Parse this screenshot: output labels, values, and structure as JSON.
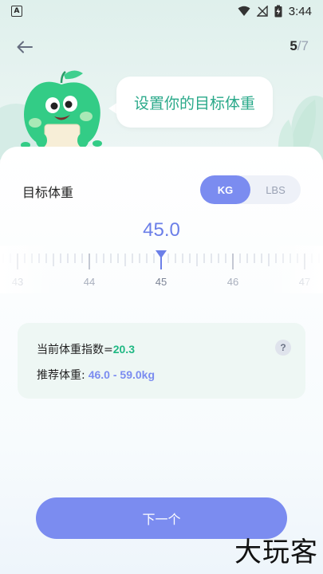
{
  "status_bar": {
    "time": "3:44",
    "left_icon": "a-notification-icon",
    "icons": [
      "wifi-icon",
      "no-signal-icon",
      "battery-charging-icon"
    ]
  },
  "nav": {
    "back_icon": "arrow-left-icon",
    "step_current": "5",
    "step_separator": "/",
    "step_total": "7"
  },
  "hero": {
    "bubble_text": "设置你的目标体重",
    "mascot": "apple-mascot"
  },
  "target_weight": {
    "label": "目标体重",
    "units": [
      {
        "label": "KG",
        "active": true
      },
      {
        "label": "LBS",
        "active": false
      }
    ],
    "value": "45.0",
    "ruler_labels": [
      "43",
      "44",
      "45",
      "46",
      "47"
    ],
    "ruler_selected": "45"
  },
  "bmi": {
    "label": "当前体重指数=",
    "value": "20.3",
    "recommend_label": "推荐体重:",
    "recommend_value": "46.0 - 59.0kg",
    "help": "?"
  },
  "next_button": "下一个",
  "watermark": "大玩客",
  "colors": {
    "accent": "#7b8cf0",
    "green": "#2aa98a",
    "bmi_value": "#1fb883"
  }
}
